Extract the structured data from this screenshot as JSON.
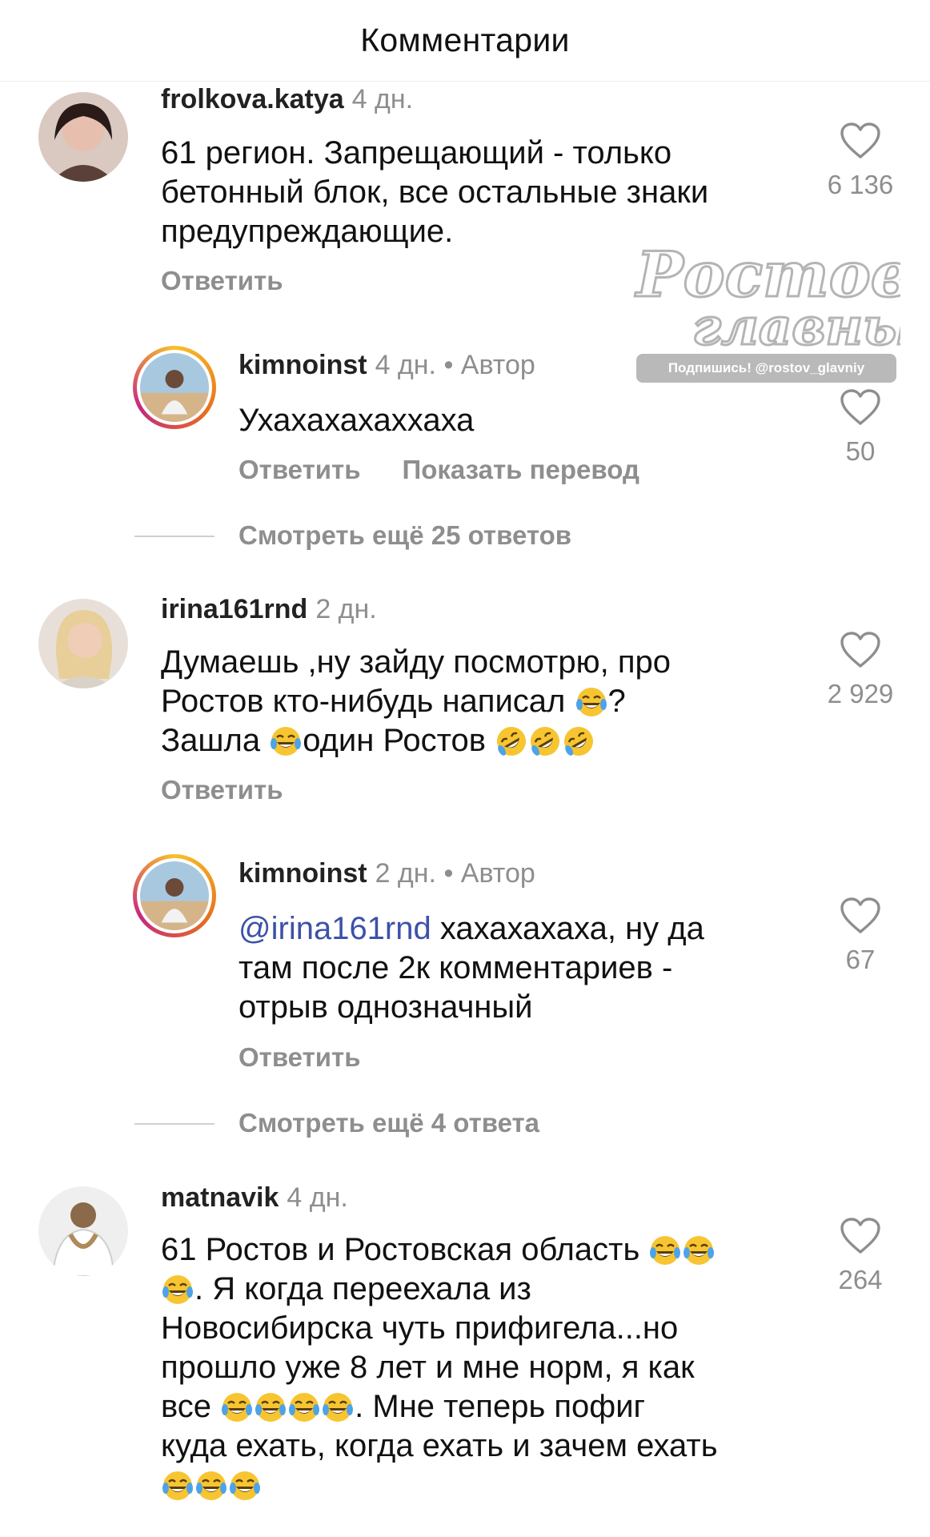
{
  "header": {
    "title": "Комментарии"
  },
  "watermark": {
    "line1": "Ростов",
    "line2": "главный",
    "badge": "Подпишись! @rostov_glavniy"
  },
  "comments": [
    {
      "username": "frolkova.katya",
      "time": "4 дн.",
      "lines": [
        "61 регион. Запрещающий - только",
        "бетонный блок, все остальные знаки",
        "предупреждающие."
      ],
      "reply_label": "Ответить",
      "likes": "6 136"
    },
    {
      "username": "kimnoinst",
      "time": "4 дн.",
      "author_tag": "• Автор",
      "text": "Ухахахахаххаха",
      "reply_label": "Ответить",
      "translate_label": "Показать перевод",
      "likes": "50"
    },
    {
      "username": "irina161rnd",
      "time": "2 дн.",
      "line1": "Думаешь ,ну зайду посмотрю, про",
      "line2_a": "Ростов кто-нибудь написал",
      "line2_b": "?",
      "line3_a": "Зашла",
      "line3_b": "один Ростов",
      "reply_label": "Ответить",
      "likes": "2 929"
    },
    {
      "username": "kimnoinst",
      "time": "2 дн.",
      "author_tag": "• Автор",
      "mention": "@irina161rnd",
      "line1_rest": " хахахахаха, ну да",
      "line2": "там после 2к комментариев -",
      "line3": "отрыв однозначный",
      "reply_label": "Ответить",
      "likes": "67"
    },
    {
      "username": "matnavik",
      "time": "4 дн.",
      "line1": "61 Ростов и Ростовская область",
      "line2": ". Я когда переехала из",
      "line3": "Новосибирска чуть прифигела...но",
      "line4": "прошло уже 8 лет и мне норм, я как",
      "line5_a": "все",
      "line5_b": ". Мне теперь пофиг",
      "line6": "куда ехать, когда ехать и зачем ехать",
      "likes": "264"
    }
  ],
  "more_replies": [
    {
      "label": "Смотреть ещё 25 ответов"
    },
    {
      "label": "Смотреть ещё 4 ответа"
    }
  ],
  "icons": {
    "like": "heart-outline-icon",
    "emoji_joy": "face-with-tears-of-joy-icon",
    "emoji_rofl": "rolling-on-the-floor-laughing-icon"
  }
}
